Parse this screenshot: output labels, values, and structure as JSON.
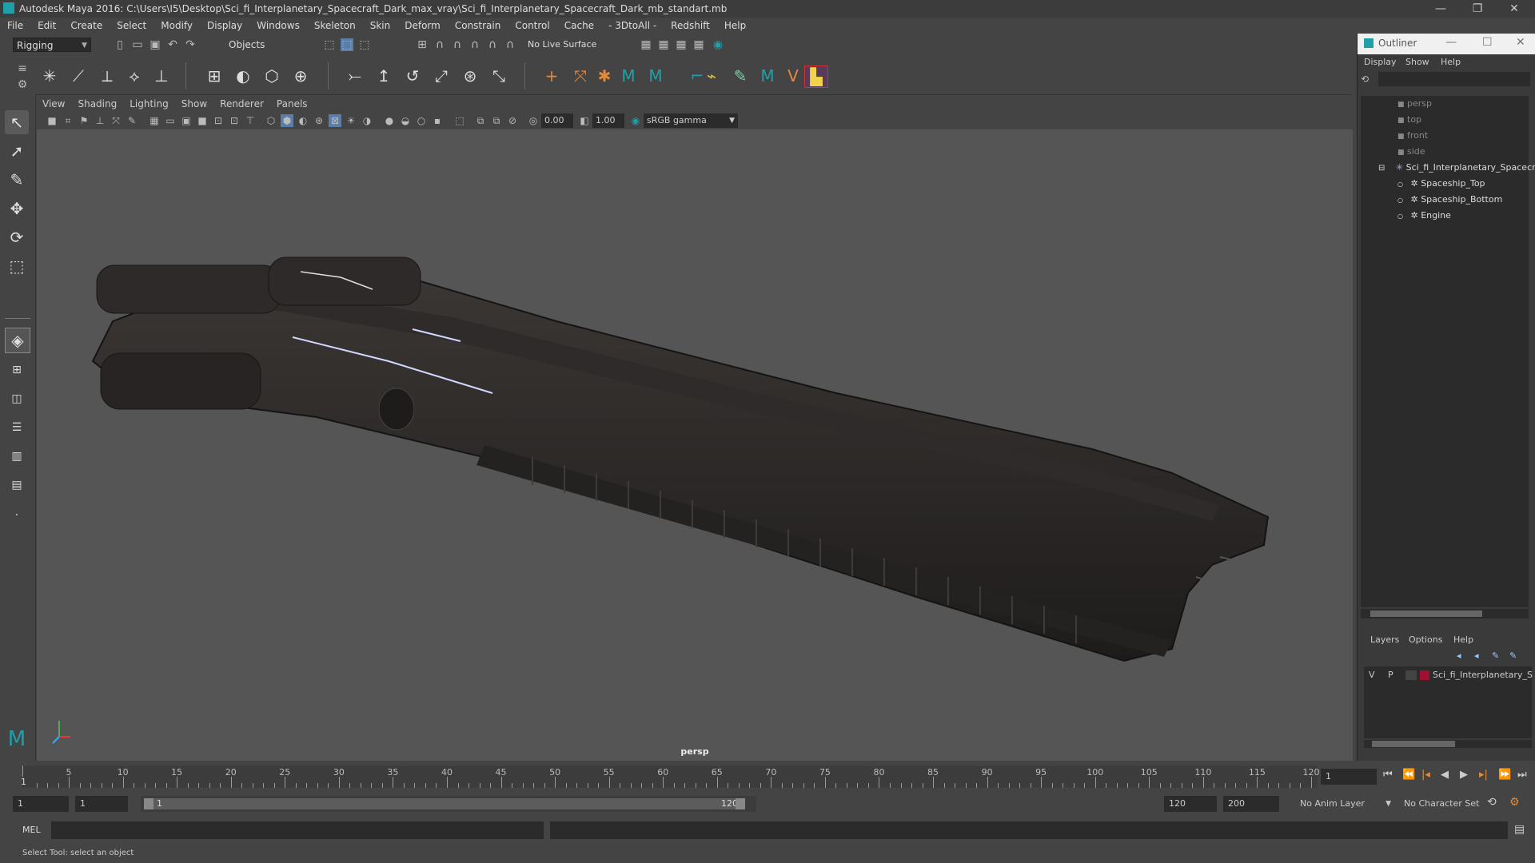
{
  "window": {
    "title": "Autodesk Maya 2016: C:\\Users\\I5\\Desktop\\Sci_fi_Interplanetary_Spacecraft_Dark_max_vray\\Sci_fi_Interplanetary_Spacecraft_Dark_mb_standart.mb",
    "minimize": "—",
    "restore": "❐",
    "close": "✕"
  },
  "menubar": [
    "File",
    "Edit",
    "Create",
    "Select",
    "Modify",
    "Display",
    "Windows",
    "Skeleton",
    "Skin",
    "Deform",
    "Constrain",
    "Control",
    "Cache",
    "- 3DtoAll -",
    "Redshift",
    "Help"
  ],
  "status_line": {
    "mode_menu": "Rigging",
    "selection_mask": "Objects",
    "live_surface": "No Live Surface"
  },
  "panel": {
    "menus": [
      "View",
      "Shading",
      "Lighting",
      "Show",
      "Renderer",
      "Panels"
    ],
    "near_value": "0.00",
    "far_value": "1.00",
    "color_space": "sRGB gamma",
    "camera_label": "persp"
  },
  "outliner": {
    "title": "Outliner",
    "menus": [
      "Display",
      "Show",
      "Help"
    ],
    "cameras": [
      "persp",
      "top",
      "front",
      "side"
    ],
    "root": "Sci_fi_Interplanetary_Spacecr",
    "children": [
      "Spaceship_Top",
      "Spaceship_Bottom",
      "Engine"
    ]
  },
  "layers": {
    "menus": [
      "Layers",
      "Options",
      "Help"
    ],
    "row": {
      "v": "V",
      "p": "P",
      "name": "Sci_fi_Interplanetary_S",
      "color": "#a01030"
    }
  },
  "timeline": {
    "ticks": [
      5,
      10,
      15,
      20,
      25,
      30,
      35,
      40,
      45,
      50,
      55,
      60,
      65,
      70,
      75,
      80,
      85,
      90,
      95,
      100,
      105,
      110,
      115,
      120
    ],
    "start_label": "1",
    "current_frame": "1"
  },
  "range": {
    "start": "1",
    "playback_start": "1",
    "slider_start": "1",
    "slider_end": "120",
    "playback_end": "120",
    "end": "200",
    "anim_layer": "No Anim Layer",
    "character_set": "No Character Set"
  },
  "command_line": {
    "label": "MEL"
  },
  "status": {
    "help_text": "Select Tool: select an object"
  },
  "colors": {
    "accent": "#1fa0a8",
    "layer": "#a01030"
  }
}
